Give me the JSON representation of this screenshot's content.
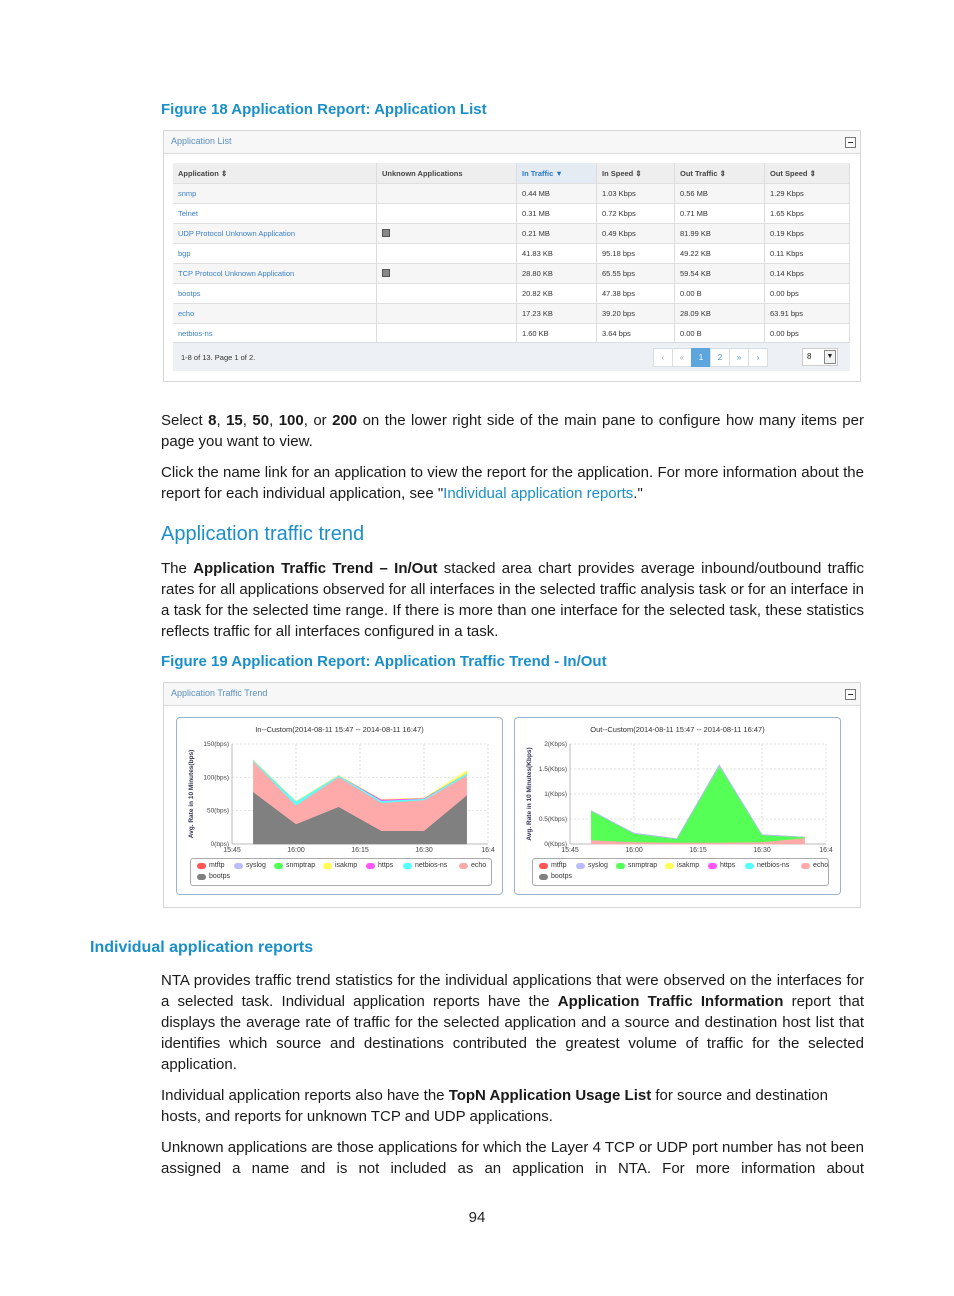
{
  "figure18": {
    "caption": "Figure 18 Application Report: Application List",
    "panel_title": "Application List",
    "columns": [
      {
        "label": "Application",
        "sort": "⇕"
      },
      {
        "label": "Unknown Applications",
        "sort": ""
      },
      {
        "label": "In Traffic",
        "sort": "▼"
      },
      {
        "label": "In Speed",
        "sort": "⇕"
      },
      {
        "label": "Out Traffic",
        "sort": "⇕"
      },
      {
        "label": "Out Speed",
        "sort": "⇕"
      }
    ],
    "rows": [
      {
        "app": "snmp",
        "unknown": false,
        "in_traffic": "0.44 MB",
        "in_speed": "1.03 Kbps",
        "out_traffic": "0.56 MB",
        "out_speed": "1.29 Kbps"
      },
      {
        "app": "Telnet",
        "unknown": false,
        "in_traffic": "0.31 MB",
        "in_speed": "0.72 Kbps",
        "out_traffic": "0.71 MB",
        "out_speed": "1.65 Kbps"
      },
      {
        "app": "UDP Protocol Unknown Application",
        "unknown": true,
        "in_traffic": "0.21 MB",
        "in_speed": "0.49 Kbps",
        "out_traffic": "81.99 KB",
        "out_speed": "0.19 Kbps"
      },
      {
        "app": "bgp",
        "unknown": false,
        "in_traffic": "41.83 KB",
        "in_speed": "95.18 bps",
        "out_traffic": "49.22 KB",
        "out_speed": "0.11 Kbps"
      },
      {
        "app": "TCP Protocol Unknown Application",
        "unknown": true,
        "in_traffic": "28.80 KB",
        "in_speed": "65.55 bps",
        "out_traffic": "59.54 KB",
        "out_speed": "0.14 Kbps"
      },
      {
        "app": "bootps",
        "unknown": false,
        "in_traffic": "20.82 KB",
        "in_speed": "47.38 bps",
        "out_traffic": "0.00 B",
        "out_speed": "0.00 bps"
      },
      {
        "app": "echo",
        "unknown": false,
        "in_traffic": "17.23 KB",
        "in_speed": "39.20 bps",
        "out_traffic": "28.09 KB",
        "out_speed": "63.91 bps"
      },
      {
        "app": "netbios-ns",
        "unknown": false,
        "in_traffic": "1.60 KB",
        "in_speed": "3.64 bps",
        "out_traffic": "0.00 B",
        "out_speed": "0.00 bps"
      }
    ],
    "pager_info": "1-8 of 13. Page 1 of 2.",
    "pager": {
      "prev": "‹",
      "first": "«",
      "pages": [
        "1",
        "2"
      ],
      "current": "1",
      "last": "»",
      "next": "›"
    },
    "per_page": "8"
  },
  "text": {
    "p1_pre": "Select ",
    "p1_b1": "8",
    "p1_s1": ", ",
    "p1_b2": "15",
    "p1_s2": ", ",
    "p1_b3": "50",
    "p1_s3": ", ",
    "p1_b4": "100",
    "p1_s4": ", or ",
    "p1_b5": "200",
    "p1_post": " on the lower right side of the main pane to configure how many items per page you want to view.",
    "p2_pre": "Click the name link for an application to view the report for the application. For more information about the report for each individual application, see \"",
    "p2_link": "Individual application reports",
    "p2_post": ".\"",
    "h_trend": "Application traffic trend",
    "p3_pre": "The ",
    "p3_bold": "Application Traffic Trend – In/Out",
    "p3_post": " stacked area chart provides average inbound/outbound traffic rates for all applications observed for all interfaces in the selected traffic analysis task or for an interface in a task for the selected time range. If there is more than one interface for the selected task, these statistics reflects traffic for all interfaces configured in a task.",
    "fig19_caption": "Figure 19 Application Report: Application Traffic Trend - In/Out",
    "h_individual": "Individual application reports",
    "p4_pre": "NTA provides traffic trend statistics for the individual applications that were observed on the interfaces for a selected task. Individual application reports have the ",
    "p4_bold": "Application Traffic Information",
    "p4_post": " report that displays the average rate of traffic for the selected application and a source and destination host list that identifies which source and destinations contributed the greatest volume of traffic for the selected application.",
    "p5_pre": "Individual application reports also have the ",
    "p5_bold": "TopN Application Usage List",
    "p5_post": " for source and destination hosts, and reports for unknown TCP and UDP applications.",
    "p6": "Unknown applications are those applications for which the Layer 4 TCP or UDP port number has not been assigned a name and is not included as an application in NTA. For more information about",
    "page_number": "94"
  },
  "figure19": {
    "panel_title": "Application Traffic Trend"
  },
  "chart_data": [
    {
      "type": "area",
      "stacked": true,
      "title": "In--Custom(2014-08-11 15:47 -- 2014-08-11 16:47)",
      "xlabel": "",
      "ylabel": "Avg. Rate in 10 Minutes(bps)",
      "x_ticks": [
        "15:45",
        "16:00",
        "16:15",
        "16:30",
        "16:4"
      ],
      "y_ticks": [
        "0(bps)",
        "50(bps)",
        "100(bps)",
        "150(bps)"
      ],
      "ylim": [
        0,
        150
      ],
      "xlim_minutes": [
        0,
        60
      ],
      "x_minutes": [
        5,
        15,
        25,
        35,
        45,
        55
      ],
      "grid": true,
      "legend_position": "bottom",
      "series": [
        {
          "name": "bootps",
          "color": "#808080",
          "values": [
            78,
            30,
            56,
            20,
            20,
            73
          ]
        },
        {
          "name": "echo",
          "color": "#ffaaaa",
          "values": [
            46,
            28,
            45,
            42,
            46,
            30
          ]
        },
        {
          "name": "netbios-ns",
          "color": "#55ffff",
          "values": [
            2,
            6,
            2,
            3,
            2,
            3
          ]
        },
        {
          "name": "https",
          "color": "#ff55ff",
          "values": [
            0,
            0,
            0,
            2,
            1,
            0
          ]
        },
        {
          "name": "isakmp",
          "color": "#ffff55",
          "values": [
            0,
            0,
            0,
            0,
            0,
            4
          ]
        },
        {
          "name": "snmptrap",
          "color": "#55ff55",
          "values": [
            0,
            0,
            0,
            0,
            0,
            0
          ]
        },
        {
          "name": "syslog",
          "color": "#bbbbff",
          "values": [
            0,
            0,
            0,
            0,
            0,
            0
          ]
        },
        {
          "name": "mtftp",
          "color": "#ff5555",
          "values": [
            0,
            0,
            0,
            0,
            0,
            0
          ]
        }
      ]
    },
    {
      "type": "area",
      "stacked": true,
      "title": "Out--Custom(2014-08-11 15:47 -- 2014-08-11 16:47)",
      "xlabel": "",
      "ylabel": "Avg. Rate in 10 Minutes(Kbps)",
      "x_ticks": [
        "15:45",
        "16:00",
        "16:15",
        "16:30",
        "16:4"
      ],
      "y_ticks": [
        "0(Kbps)",
        "0.5(Kbps)",
        "1(Kbps)",
        "1.5(Kbps)",
        "2(Kbps)"
      ],
      "ylim": [
        0,
        2
      ],
      "xlim_minutes": [
        0,
        60
      ],
      "x_minutes": [
        5,
        15,
        25,
        35,
        45,
        55
      ],
      "grid": true,
      "legend_position": "bottom",
      "series": [
        {
          "name": "echo",
          "color": "#ffaaaa",
          "values": [
            0.08,
            0.04,
            0.03,
            0.03,
            0.04,
            0.12
          ]
        },
        {
          "name": "snmptrap",
          "color": "#55ff55",
          "values": [
            0.58,
            0.17,
            0.07,
            1.53,
            0.14,
            0.02
          ]
        },
        {
          "name": "syslog",
          "color": "#bbbbff",
          "values": [
            0.01,
            0.01,
            0.01,
            0.03,
            0.01,
            0.0
          ]
        },
        {
          "name": "bootps",
          "color": "#808080",
          "values": [
            0,
            0,
            0,
            0,
            0,
            0
          ]
        },
        {
          "name": "netbios-ns",
          "color": "#55ffff",
          "values": [
            0,
            0,
            0,
            0,
            0,
            0
          ]
        },
        {
          "name": "https",
          "color": "#ff55ff",
          "values": [
            0,
            0,
            0,
            0,
            0,
            0
          ]
        },
        {
          "name": "isakmp",
          "color": "#ffff55",
          "values": [
            0,
            0,
            0,
            0,
            0,
            0
          ]
        },
        {
          "name": "mtftp",
          "color": "#ff5555",
          "values": [
            0,
            0,
            0,
            0,
            0,
            0
          ]
        }
      ]
    }
  ],
  "legend": [
    {
      "name": "mtftp",
      "color": "#ff5555"
    },
    {
      "name": "syslog",
      "color": "#bbbbff"
    },
    {
      "name": "snmptrap",
      "color": "#55ff55"
    },
    {
      "name": "isakmp",
      "color": "#ffff55"
    },
    {
      "name": "https",
      "color": "#ff55ff"
    },
    {
      "name": "netbios-ns",
      "color": "#55ffff"
    },
    {
      "name": "echo",
      "color": "#ffaaaa"
    },
    {
      "name": "bootps",
      "color": "#808080"
    }
  ]
}
